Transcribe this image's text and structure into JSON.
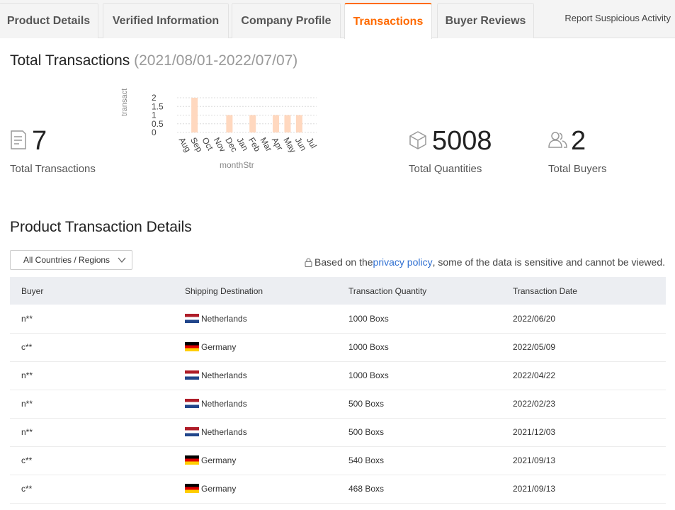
{
  "tabs": [
    {
      "label": "Product Details",
      "active": false
    },
    {
      "label": "Verified Information",
      "active": false
    },
    {
      "label": "Company Profile",
      "active": false
    },
    {
      "label": "Transactions",
      "active": true
    },
    {
      "label": "Buyer Reviews",
      "active": false
    }
  ],
  "report_label": "Report Suspicious Activity",
  "totals": {
    "title": "Total Transactions",
    "range": "(2021/08/01-2022/07/07)",
    "transactions": {
      "value": "7",
      "label": "Total Transactions"
    },
    "quantities": {
      "value": "5008",
      "label": "Total Quantities"
    },
    "buyers": {
      "value": "2",
      "label": "Total Buyers"
    }
  },
  "chart_data": {
    "type": "bar",
    "categories": [
      "Aug",
      "Sep",
      "Oct",
      "Nov",
      "Dec",
      "Jan",
      "Feb",
      "Mar",
      "Apr",
      "May",
      "Jun",
      "Jul"
    ],
    "values": [
      0,
      2,
      0,
      0,
      1,
      0,
      1,
      0,
      1,
      1,
      1,
      0
    ],
    "ylabel": "transact",
    "xlabel": "monthStr",
    "yticks": [
      "0",
      "0.5",
      "1",
      "1.5",
      "2"
    ],
    "ylim": [
      0,
      2
    ],
    "grid": true,
    "bar_color": "#ffd8bf"
  },
  "details": {
    "title": "Product Transaction Details",
    "region_select": "All Countries / Regions",
    "privacy_prefix": "Based on the ",
    "privacy_link": "privacy policy",
    "privacy_suffix": ", some of the data is sensitive and cannot be viewed.",
    "columns": [
      "Buyer",
      "Shipping Destination",
      "Transaction Quantity",
      "Transaction Date"
    ],
    "rows": [
      {
        "buyer": "n**",
        "country": "Netherlands",
        "flag": "nl",
        "quantity": "1000 Boxs",
        "date": "2022/06/20"
      },
      {
        "buyer": "c**",
        "country": "Germany",
        "flag": "de",
        "quantity": "1000 Boxs",
        "date": "2022/05/09"
      },
      {
        "buyer": "n**",
        "country": "Netherlands",
        "flag": "nl",
        "quantity": "1000 Boxs",
        "date": "2022/04/22"
      },
      {
        "buyer": "n**",
        "country": "Netherlands",
        "flag": "nl",
        "quantity": "500 Boxs",
        "date": "2022/02/23"
      },
      {
        "buyer": "n**",
        "country": "Netherlands",
        "flag": "nl",
        "quantity": "500 Boxs",
        "date": "2021/12/03"
      },
      {
        "buyer": "c**",
        "country": "Germany",
        "flag": "de",
        "quantity": "540 Boxs",
        "date": "2021/09/13"
      },
      {
        "buyer": "c**",
        "country": "Germany",
        "flag": "de",
        "quantity": "468 Boxs",
        "date": "2021/09/13"
      }
    ]
  },
  "colors": {
    "accent": "#ff6a00",
    "link": "#2f6fd1"
  }
}
